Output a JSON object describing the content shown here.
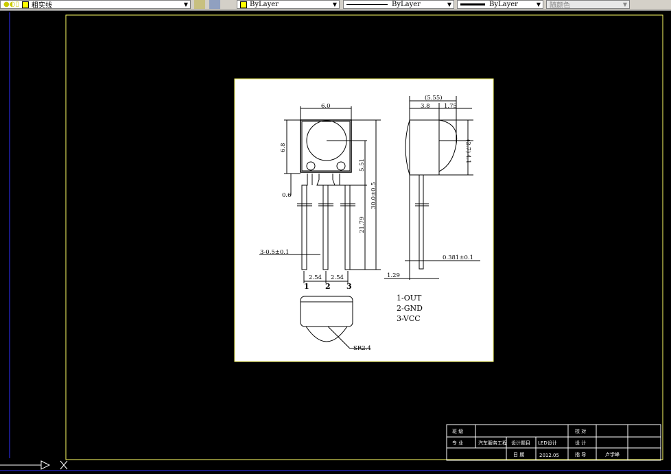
{
  "toolbar": {
    "layer": "粗实线",
    "color": "ByLayer",
    "linetype": "ByLayer",
    "lineweight": "ByLayer",
    "plotstyle": "随颜色"
  },
  "drawing": {
    "dims": {
      "width": "6.0",
      "height": "6.8",
      "lens_offset": "5.51",
      "total_len": "30.0±0.5",
      "lead_len": "21.79",
      "tab": "0.6",
      "lead_w": "3-0.5±0.1",
      "pitch1": "2.54",
      "pitch2": "2.54",
      "side_total": "(5.55)",
      "side_body": "3.8",
      "side_dome": "1.75",
      "dome_h": "(2.7)",
      "dome_low": "4.1",
      "lead_t": "0.381±0.1",
      "lead_off": "1.29",
      "radius": "SR2.4"
    },
    "pins": [
      "1",
      "2",
      "3"
    ],
    "pinout": [
      "1-OUT",
      "2-GND",
      "3-VCC"
    ]
  },
  "title_block": {
    "r1": [
      "班 级",
      "",
      "校 对",
      "",
      ""
    ],
    "r2": [
      "专 业",
      "汽车服务工程",
      "设计题目",
      "LED设计",
      "设 计",
      "",
      ""
    ],
    "r3": [
      "",
      "日 期",
      "2012.05",
      "指 导",
      "卢学峰",
      ""
    ]
  },
  "colors": {
    "frame": "#ffff66",
    "background": "#000000",
    "sheet": "#ffffff"
  }
}
